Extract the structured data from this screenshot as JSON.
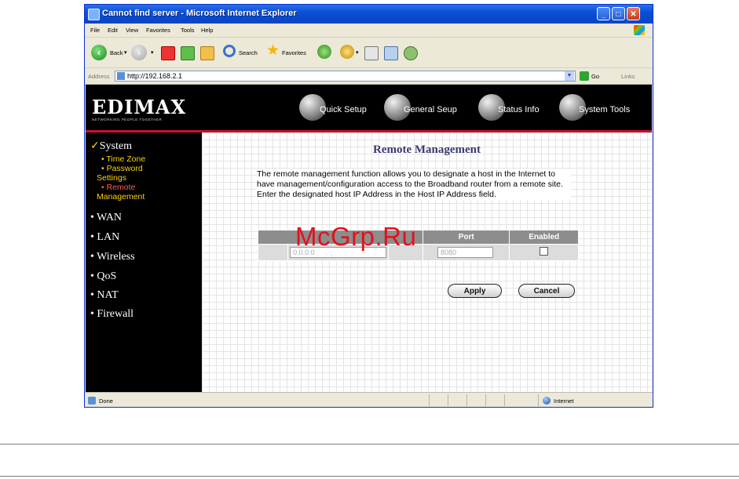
{
  "window": {
    "title": "Cannot find server - Microsoft Internet Explorer"
  },
  "menu": [
    "File",
    "Edit",
    "View",
    "Favorites",
    "Tools",
    "Help"
  ],
  "toolbar": {
    "back": "Back",
    "search": "Search",
    "favorites": "Favorites"
  },
  "address": {
    "label": "Address",
    "url": "http://192.168.2.1",
    "go": "Go",
    "links": "Links"
  },
  "router": {
    "logo": "EDIMAX",
    "logo_tagline": "NETWORKING PEOPLE TOGETHER",
    "nav": [
      "Quick Setup",
      "General Seup",
      "Status Info",
      "System Tools"
    ],
    "sidebar": {
      "system": "System",
      "time_zone": "Time Zone",
      "password": "Password",
      "settings": "Settings",
      "remote": "Remote",
      "management": "Management",
      "sections": [
        "WAN",
        "LAN",
        "Wireless",
        "QoS",
        "NAT",
        "Firewall"
      ]
    },
    "page_title": "Remote Management",
    "description": "The remote management function allows you to designate a host in the Internet to have management/configuration access to the Broadband router from a remote site. Enter the designated host IP Address in the Host IP Address field.",
    "table": {
      "headers": [
        "",
        "Port",
        "Enabled"
      ],
      "host_ip_placeholder": "0.0.0.0",
      "port_placeholder": "8080",
      "enabled": false
    },
    "apply": "Apply",
    "cancel": "Cancel"
  },
  "status": {
    "text": "Done",
    "zone": "Internet"
  },
  "watermark": "McGrp.Ru",
  "colors": {
    "title_blue": "#0a4fd6",
    "accent_red": "#c8102e",
    "sidebar_yellow": "#ffd200"
  }
}
